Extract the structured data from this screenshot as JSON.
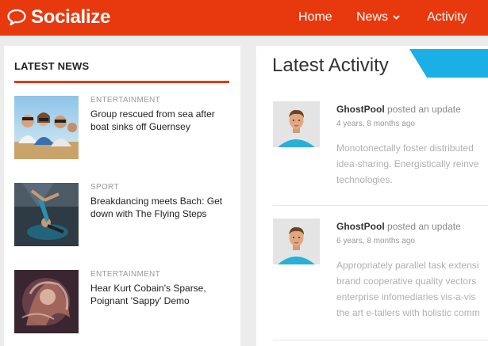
{
  "header": {
    "logo_text": "Socialize",
    "logo_icon": "speech-bubble-icon",
    "nav": {
      "home": "Home",
      "news": "News",
      "activity": "Activity"
    },
    "brand_color": "#e8390e"
  },
  "latest_news": {
    "title": "LATEST NEWS",
    "items": [
      {
        "category": "ENTERTAINMENT",
        "title": "Group rescued from sea after boat sinks off Guernsey",
        "thumb": "group-friends-photo"
      },
      {
        "category": "SPORT",
        "title": "Breakdancing meets Bach: Get down with The Flying Steps",
        "thumb": "breakdancer-photo"
      },
      {
        "category": "ENTERTAINMENT",
        "title": "Hear Kurt Cobain's Sparse, Poignant 'Sappy' Demo",
        "thumb": "abstract-portrait-photo"
      }
    ]
  },
  "latest_activity": {
    "title": "Latest Activity",
    "accent_color": "#1ab0e6",
    "items": [
      {
        "user": "GhostPool",
        "action": "posted an update",
        "time": "4 years, 8 months ago",
        "lines": [
          "Monotonectally foster distributed",
          "idea-sharing. Energistically reinve",
          "technologies."
        ]
      },
      {
        "user": "GhostPool",
        "action": "posted an update",
        "time": "6 years, 8 months ago",
        "lines": [
          "Appropriately parallel task extensi",
          "brand cooperative quality vectors",
          "enterprise infomediaries vis-a-vis",
          "the art e-tailers with holistic comm"
        ]
      }
    ]
  }
}
